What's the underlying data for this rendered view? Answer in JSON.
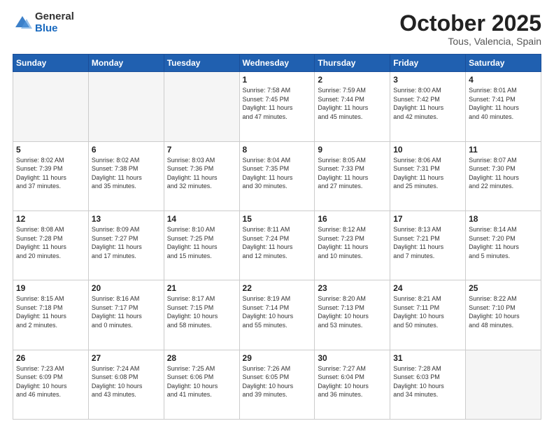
{
  "header": {
    "logo_general": "General",
    "logo_blue": "Blue",
    "title": "October 2025",
    "location": "Tous, Valencia, Spain"
  },
  "weekdays": [
    "Sunday",
    "Monday",
    "Tuesday",
    "Wednesday",
    "Thursday",
    "Friday",
    "Saturday"
  ],
  "weeks": [
    [
      {
        "day": "",
        "info": ""
      },
      {
        "day": "",
        "info": ""
      },
      {
        "day": "",
        "info": ""
      },
      {
        "day": "1",
        "info": "Sunrise: 7:58 AM\nSunset: 7:45 PM\nDaylight: 11 hours\nand 47 minutes."
      },
      {
        "day": "2",
        "info": "Sunrise: 7:59 AM\nSunset: 7:44 PM\nDaylight: 11 hours\nand 45 minutes."
      },
      {
        "day": "3",
        "info": "Sunrise: 8:00 AM\nSunset: 7:42 PM\nDaylight: 11 hours\nand 42 minutes."
      },
      {
        "day": "4",
        "info": "Sunrise: 8:01 AM\nSunset: 7:41 PM\nDaylight: 11 hours\nand 40 minutes."
      }
    ],
    [
      {
        "day": "5",
        "info": "Sunrise: 8:02 AM\nSunset: 7:39 PM\nDaylight: 11 hours\nand 37 minutes."
      },
      {
        "day": "6",
        "info": "Sunrise: 8:02 AM\nSunset: 7:38 PM\nDaylight: 11 hours\nand 35 minutes."
      },
      {
        "day": "7",
        "info": "Sunrise: 8:03 AM\nSunset: 7:36 PM\nDaylight: 11 hours\nand 32 minutes."
      },
      {
        "day": "8",
        "info": "Sunrise: 8:04 AM\nSunset: 7:35 PM\nDaylight: 11 hours\nand 30 minutes."
      },
      {
        "day": "9",
        "info": "Sunrise: 8:05 AM\nSunset: 7:33 PM\nDaylight: 11 hours\nand 27 minutes."
      },
      {
        "day": "10",
        "info": "Sunrise: 8:06 AM\nSunset: 7:31 PM\nDaylight: 11 hours\nand 25 minutes."
      },
      {
        "day": "11",
        "info": "Sunrise: 8:07 AM\nSunset: 7:30 PM\nDaylight: 11 hours\nand 22 minutes."
      }
    ],
    [
      {
        "day": "12",
        "info": "Sunrise: 8:08 AM\nSunset: 7:28 PM\nDaylight: 11 hours\nand 20 minutes."
      },
      {
        "day": "13",
        "info": "Sunrise: 8:09 AM\nSunset: 7:27 PM\nDaylight: 11 hours\nand 17 minutes."
      },
      {
        "day": "14",
        "info": "Sunrise: 8:10 AM\nSunset: 7:25 PM\nDaylight: 11 hours\nand 15 minutes."
      },
      {
        "day": "15",
        "info": "Sunrise: 8:11 AM\nSunset: 7:24 PM\nDaylight: 11 hours\nand 12 minutes."
      },
      {
        "day": "16",
        "info": "Sunrise: 8:12 AM\nSunset: 7:23 PM\nDaylight: 11 hours\nand 10 minutes."
      },
      {
        "day": "17",
        "info": "Sunrise: 8:13 AM\nSunset: 7:21 PM\nDaylight: 11 hours\nand 7 minutes."
      },
      {
        "day": "18",
        "info": "Sunrise: 8:14 AM\nSunset: 7:20 PM\nDaylight: 11 hours\nand 5 minutes."
      }
    ],
    [
      {
        "day": "19",
        "info": "Sunrise: 8:15 AM\nSunset: 7:18 PM\nDaylight: 11 hours\nand 2 minutes."
      },
      {
        "day": "20",
        "info": "Sunrise: 8:16 AM\nSunset: 7:17 PM\nDaylight: 11 hours\nand 0 minutes."
      },
      {
        "day": "21",
        "info": "Sunrise: 8:17 AM\nSunset: 7:15 PM\nDaylight: 10 hours\nand 58 minutes."
      },
      {
        "day": "22",
        "info": "Sunrise: 8:19 AM\nSunset: 7:14 PM\nDaylight: 10 hours\nand 55 minutes."
      },
      {
        "day": "23",
        "info": "Sunrise: 8:20 AM\nSunset: 7:13 PM\nDaylight: 10 hours\nand 53 minutes."
      },
      {
        "day": "24",
        "info": "Sunrise: 8:21 AM\nSunset: 7:11 PM\nDaylight: 10 hours\nand 50 minutes."
      },
      {
        "day": "25",
        "info": "Sunrise: 8:22 AM\nSunset: 7:10 PM\nDaylight: 10 hours\nand 48 minutes."
      }
    ],
    [
      {
        "day": "26",
        "info": "Sunrise: 7:23 AM\nSunset: 6:09 PM\nDaylight: 10 hours\nand 46 minutes."
      },
      {
        "day": "27",
        "info": "Sunrise: 7:24 AM\nSunset: 6:08 PM\nDaylight: 10 hours\nand 43 minutes."
      },
      {
        "day": "28",
        "info": "Sunrise: 7:25 AM\nSunset: 6:06 PM\nDaylight: 10 hours\nand 41 minutes."
      },
      {
        "day": "29",
        "info": "Sunrise: 7:26 AM\nSunset: 6:05 PM\nDaylight: 10 hours\nand 39 minutes."
      },
      {
        "day": "30",
        "info": "Sunrise: 7:27 AM\nSunset: 6:04 PM\nDaylight: 10 hours\nand 36 minutes."
      },
      {
        "day": "31",
        "info": "Sunrise: 7:28 AM\nSunset: 6:03 PM\nDaylight: 10 hours\nand 34 minutes."
      },
      {
        "day": "",
        "info": ""
      }
    ]
  ]
}
